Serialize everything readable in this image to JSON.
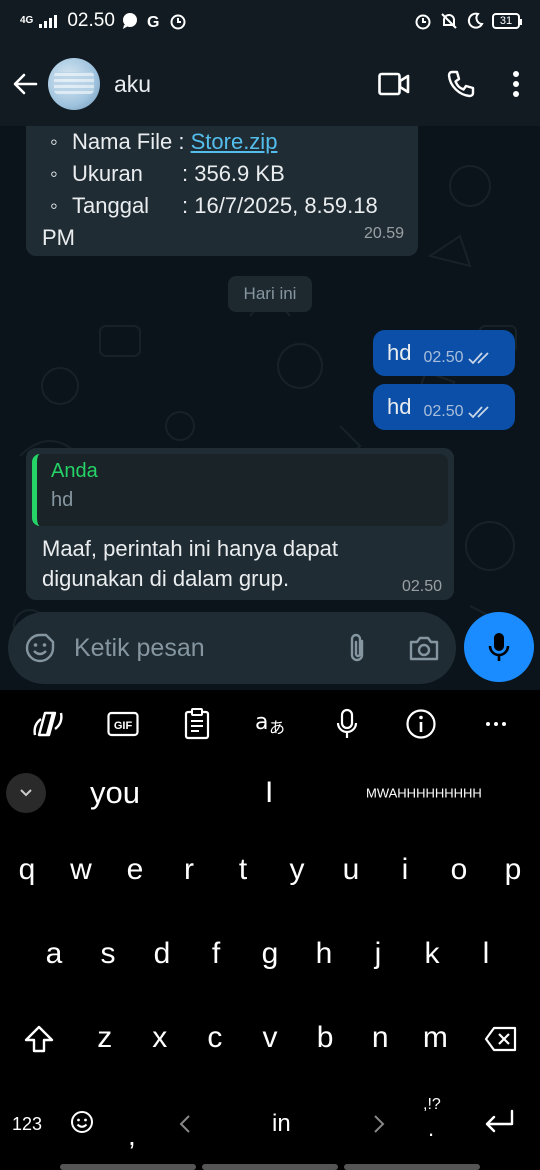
{
  "status": {
    "network": "4G",
    "time": "02.50",
    "battery": "31"
  },
  "header": {
    "contact_name": "aku"
  },
  "messages": {
    "file_info": {
      "name_label": "Nama File :",
      "name_value": "Store.zip",
      "size_label": "Ukuran",
      "size_value": ": 356.9 KB",
      "date_label": "Tanggal",
      "date_value": ": 16/7/2025, 8.59.18",
      "date_tail": "PM",
      "time": "20.59"
    },
    "day_separator": "Hari ini",
    "outgoing": [
      {
        "text": "hd",
        "time": "02.50"
      },
      {
        "text": "hd",
        "time": "02.50"
      }
    ],
    "reply": {
      "quoted_name": "Anda",
      "quoted_text": "hd",
      "text_line1": "Maaf, perintah ini hanya dapat",
      "text_line2": "digunakan di dalam grup.",
      "time": "02.50"
    }
  },
  "composer": {
    "placeholder": "Ketik pesan"
  },
  "keyboard": {
    "toolbar_gif": "GIF",
    "suggestions": [
      "you",
      "I",
      "MWAHHHHHHHHH"
    ],
    "row1": [
      "q",
      "w",
      "e",
      "r",
      "t",
      "y",
      "u",
      "i",
      "o",
      "p"
    ],
    "row2": [
      "a",
      "s",
      "d",
      "f",
      "g",
      "h",
      "j",
      "k",
      "l"
    ],
    "row3": [
      "z",
      "x",
      "c",
      "v",
      "b",
      "n",
      "m"
    ],
    "numbers_key": "123",
    "comma_key": ",",
    "space_suggestion": "in",
    "punct_key": ",!?",
    "period_key": "."
  },
  "colors": {
    "outgoing_bubble": "#0b4fa8",
    "incoming_bubble": "#202c33",
    "accent_green": "#25d366",
    "link": "#53bdeb",
    "mic_button": "#1a8cff"
  }
}
